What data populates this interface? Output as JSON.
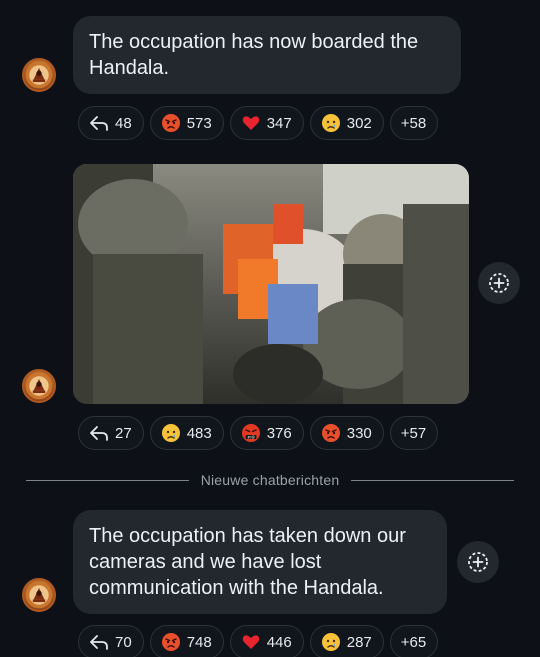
{
  "messages": [
    {
      "text": "The occupation has now boarded the Handala.",
      "reactions": [
        {
          "type": "reply",
          "icon": "reply-arrow-icon",
          "count": "48"
        },
        {
          "type": "emoji",
          "icon": "angry-face-icon",
          "count": "573"
        },
        {
          "type": "emoji",
          "icon": "red-heart-icon",
          "count": "347"
        },
        {
          "type": "emoji",
          "icon": "crying-face-icon",
          "count": "302"
        },
        {
          "type": "more",
          "label": "+58"
        }
      ]
    },
    {
      "media": "video-thumbnail",
      "reactions": [
        {
          "type": "reply",
          "icon": "reply-arrow-icon",
          "count": "27"
        },
        {
          "type": "emoji",
          "icon": "crying-face-icon",
          "count": "483"
        },
        {
          "type": "emoji",
          "icon": "cursing-face-icon",
          "count": "376"
        },
        {
          "type": "emoji",
          "icon": "angry-face-icon",
          "count": "330"
        },
        {
          "type": "more",
          "label": "+57"
        }
      ]
    },
    {
      "text": "The occupation has taken down our cameras and we have lost communication with the Handala.",
      "reactions": [
        {
          "type": "reply",
          "icon": "reply-arrow-icon",
          "count": "70"
        },
        {
          "type": "emoji",
          "icon": "angry-face-icon",
          "count": "748"
        },
        {
          "type": "emoji",
          "icon": "red-heart-icon",
          "count": "446"
        },
        {
          "type": "emoji",
          "icon": "crying-face-icon",
          "count": "287"
        },
        {
          "type": "more",
          "label": "+65"
        }
      ]
    }
  ],
  "divider": {
    "label": "Nieuwe chatberichten"
  },
  "colors": {
    "background": "#0d1117",
    "bubble": "#23272e",
    "pill_border": "#2c323a",
    "text": "#eef1f4",
    "muted": "#9aa1a8"
  }
}
